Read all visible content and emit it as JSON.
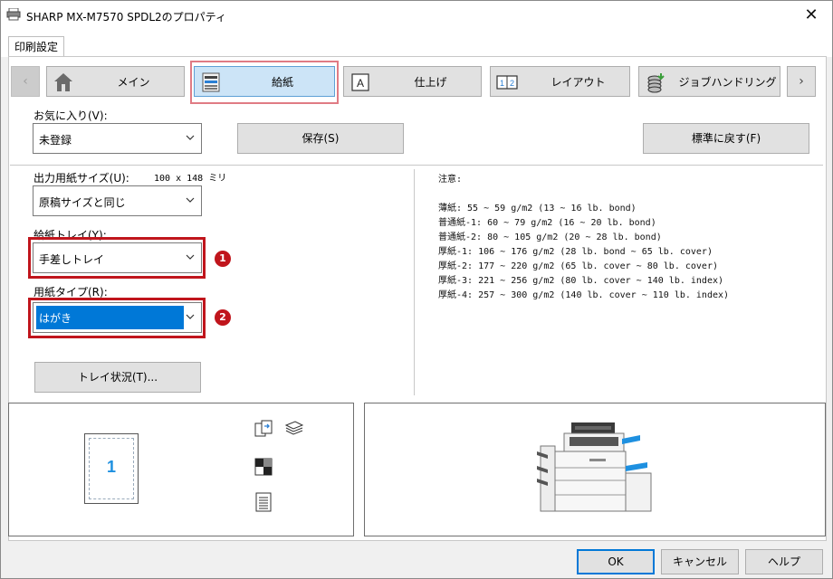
{
  "window": {
    "title": "SHARP MX-M7570 SPDL2のプロパティ",
    "close_glyph": "✕"
  },
  "tabs": [
    {
      "label": "印刷設定"
    }
  ],
  "nav": {
    "prev_glyph": "‹",
    "next_glyph": "›",
    "items": [
      {
        "label": "メイン",
        "icon": "home-icon"
      },
      {
        "label": "給紙",
        "icon": "paper-tray-icon",
        "active": true
      },
      {
        "label": "仕上げ",
        "icon": "finishing-icon"
      },
      {
        "label": "レイアウト",
        "icon": "layout-icon"
      },
      {
        "label": "ジョブハンドリング",
        "icon": "job-handling-icon"
      }
    ]
  },
  "favorites": {
    "label": "お気に入り(V):",
    "value": "未登録",
    "save_label": "保存(S)",
    "reset_label": "標準に戻す(F)"
  },
  "output_size": {
    "label": "出力用紙サイズ(U):",
    "dimension": "100 x 148 ミリ",
    "value": "原稿サイズと同じ"
  },
  "paper_tray": {
    "label": "給紙トレイ(Y):",
    "value": "手差しトレイ",
    "badge": "1"
  },
  "paper_type": {
    "label": "用紙タイプ(R):",
    "value": "はがき",
    "badge": "2"
  },
  "tray_status_label": "トレイ状況(T)...",
  "notes": {
    "title": "注意:",
    "lines": [
      "薄紙: 55 ~ 59 g/m2 (13 ~ 16 lb. bond)",
      "普通紙-1: 60 ~ 79 g/m2 (16 ~ 20 lb. bond)",
      "普通紙-2: 80 ~ 105 g/m2 (20 ~ 28 lb. bond)",
      "厚紙-1: 106 ~ 176 g/m2 (28 lb. bond ~ 65 lb. cover)",
      "厚紙-2: 177 ~ 220 g/m2 (65 lb. cover ~ 80 lb. cover)",
      "厚紙-3: 221 ~ 256 g/m2 (80 lb. cover ~ 140 lb. index)",
      "厚紙-4: 257 ~ 300 g/m2 (140 lb. cover ~ 110 lb. index)"
    ]
  },
  "preview": {
    "page_number": "1"
  },
  "footer": {
    "ok_label": "OK",
    "cancel_label": "キャンセル",
    "help_label": "ヘルプ"
  },
  "colors": {
    "accent": "#0078d7",
    "selected_bg": "#cce4f7",
    "callout_red": "#c0151c",
    "highlight_pink": "#e07b84"
  }
}
